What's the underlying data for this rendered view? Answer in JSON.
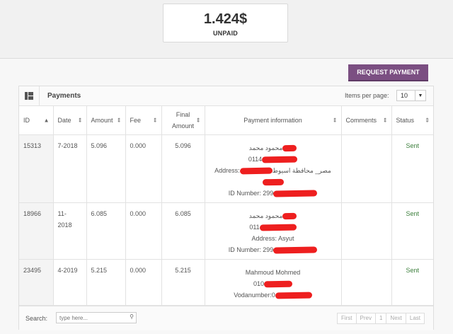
{
  "summary": {
    "value": "1.424$",
    "label": "UNPAID"
  },
  "request_button": "REQUEST PAYMENT",
  "panel": {
    "title": "Payments",
    "items_per_page_label": "Items per page:",
    "items_per_page_value": "10"
  },
  "columns": [
    "ID",
    "Date",
    "Amount",
    "Fee",
    "Final Amount",
    "Payment information",
    "Comments",
    "Status"
  ],
  "rows": [
    {
      "id": "15313",
      "date": "7-2018",
      "amount": "5.096",
      "fee": "0.000",
      "final": "5.096",
      "info": [
        "محمود محمد",
        "0114",
        "Address:",
        "مصر_ محافظة اسيوط",
        "ID Number: 299"
      ],
      "comments": "",
      "status": "Sent"
    },
    {
      "id": "18966",
      "date": "11-2018",
      "amount": "6.085",
      "fee": "0.000",
      "final": "6.085",
      "info": [
        "محمود محمد",
        "011",
        "Address: Asyut",
        "ID Number: 299"
      ],
      "comments": "",
      "status": "Sent"
    },
    {
      "id": "23495",
      "date": "4-2019",
      "amount": "5.215",
      "fee": "0.000",
      "final": "5.215",
      "info": [
        "Mahmoud Mohmed",
        "010",
        "Vodanumber:0"
      ],
      "comments": "",
      "status": "Sent"
    }
  ],
  "footer": {
    "search_label": "Search:",
    "search_placeholder": "type here...",
    "pager": [
      "First",
      "Prev",
      "1",
      "Next",
      "Last"
    ]
  },
  "colors": {
    "accent": "#7b4f82",
    "status_sent": "#3c7f3c",
    "redaction": "#ee1f1f"
  }
}
